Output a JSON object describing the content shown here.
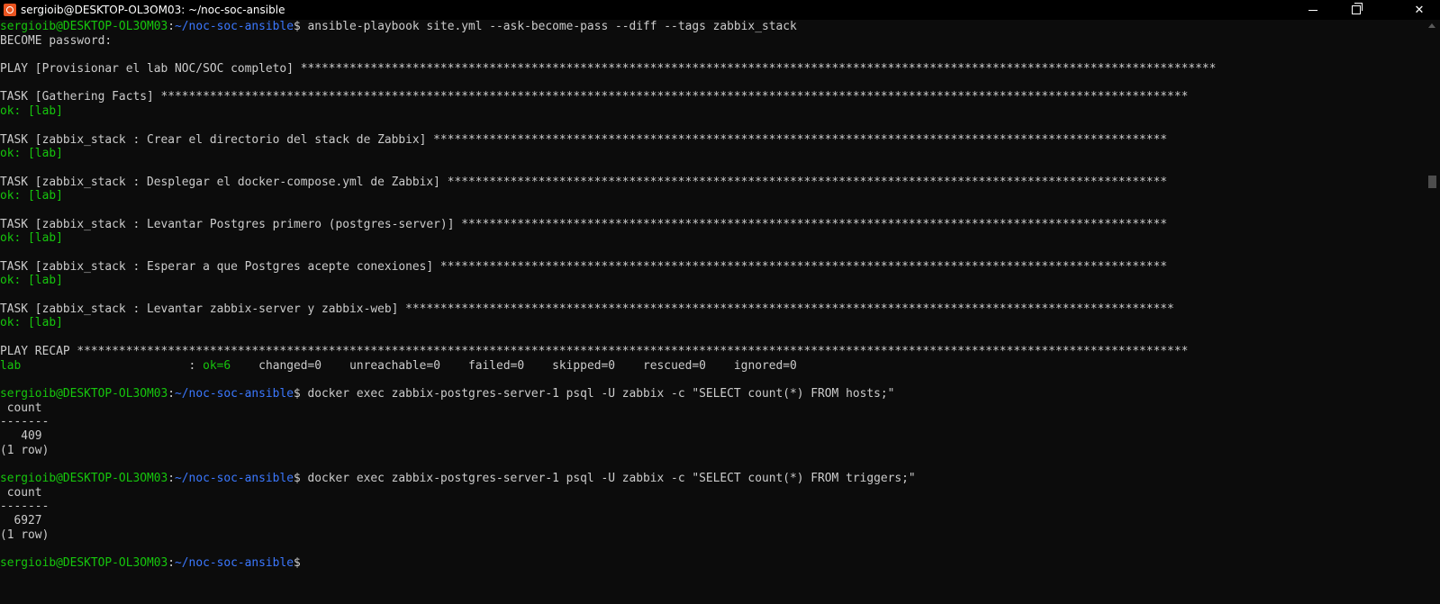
{
  "window": {
    "title": "sergioib@DESKTOP-OL3OM03: ~/noc-soc-ansible",
    "icon": "ubuntu-icon"
  },
  "prompt": {
    "user_host": "sergioib@DESKTOP-OL3OM03",
    "path": "~/noc-soc-ansible",
    "symbol": "$"
  },
  "lines": [
    {
      "type": "prompt",
      "cmd": " ansible-playbook site.yml --ask-become-pass --diff --tags zabbix_stack"
    },
    {
      "type": "text",
      "text": "BECOME password:"
    },
    {
      "type": "blank"
    },
    {
      "type": "header",
      "text": "PLAY [Provisionar el lab NOC/SOC completo] ***********************************************************************************************************************************"
    },
    {
      "type": "blank"
    },
    {
      "type": "header",
      "text": "TASK [Gathering Facts] ***************************************************************************************************************************************************"
    },
    {
      "type": "ok",
      "text": "ok: [lab]"
    },
    {
      "type": "blank"
    },
    {
      "type": "header",
      "text": "TASK [zabbix_stack : Crear el directorio del stack de Zabbix] *********************************************************************************************************"
    },
    {
      "type": "ok",
      "text": "ok: [lab]"
    },
    {
      "type": "blank"
    },
    {
      "type": "header",
      "text": "TASK [zabbix_stack : Desplegar el docker-compose.yml de Zabbix] *******************************************************************************************************"
    },
    {
      "type": "ok",
      "text": "ok: [lab]"
    },
    {
      "type": "blank"
    },
    {
      "type": "header",
      "text": "TASK [zabbix_stack : Levantar Postgres primero (postgres-server)] *****************************************************************************************************"
    },
    {
      "type": "ok",
      "text": "ok: [lab]"
    },
    {
      "type": "blank"
    },
    {
      "type": "header",
      "text": "TASK [zabbix_stack : Esperar a que Postgres acepte conexiones] ********************************************************************************************************"
    },
    {
      "type": "ok",
      "text": "ok: [lab]"
    },
    {
      "type": "blank"
    },
    {
      "type": "header",
      "text": "TASK [zabbix_stack : Levantar zabbix-server y zabbix-web] **************************************************************************************************************"
    },
    {
      "type": "ok",
      "text": "ok: [lab]"
    },
    {
      "type": "blank"
    },
    {
      "type": "header",
      "text": "PLAY RECAP ***************************************************************************************************************************************************************"
    },
    {
      "type": "recap",
      "host": "lab",
      "pad": "                        : ",
      "ok": "ok=6",
      "rest": "    changed=0    unreachable=0    failed=0    skipped=0    rescued=0    ignored=0"
    },
    {
      "type": "blank"
    },
    {
      "type": "prompt",
      "cmd": " docker exec zabbix-postgres-server-1 psql -U zabbix -c \"SELECT count(*) FROM hosts;\""
    },
    {
      "type": "text",
      "text": " count"
    },
    {
      "type": "text",
      "text": "-------"
    },
    {
      "type": "text",
      "text": "   409"
    },
    {
      "type": "text",
      "text": "(1 row)"
    },
    {
      "type": "blank"
    },
    {
      "type": "prompt",
      "cmd": " docker exec zabbix-postgres-server-1 psql -U zabbix -c \"SELECT count(*) FROM triggers;\""
    },
    {
      "type": "text",
      "text": " count"
    },
    {
      "type": "text",
      "text": "-------"
    },
    {
      "type": "text",
      "text": "  6927"
    },
    {
      "type": "text",
      "text": "(1 row)"
    },
    {
      "type": "blank"
    },
    {
      "type": "prompt",
      "cmd": ""
    }
  ],
  "colors": {
    "background": "#0c0c0c",
    "text": "#cccccc",
    "green": "#16c60c",
    "blue": "#3b78ff"
  }
}
